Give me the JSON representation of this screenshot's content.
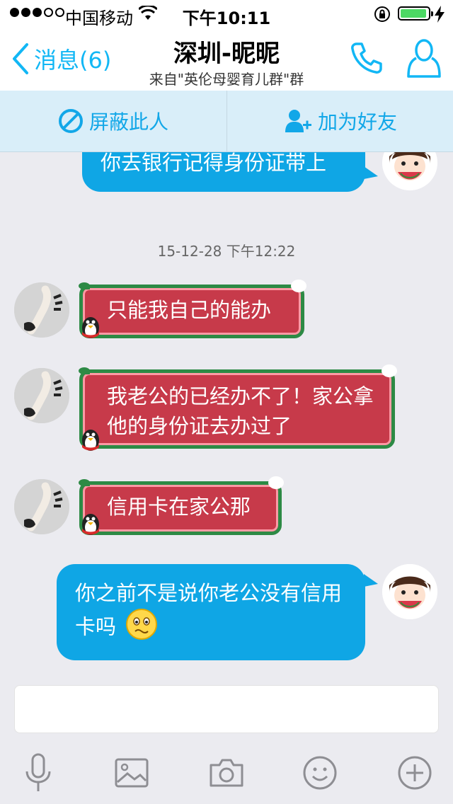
{
  "status_bar": {
    "carrier": "中国移动",
    "time": "下午10:11",
    "battery_level": 0.95
  },
  "nav": {
    "back_label": "消息(6)",
    "title": "深圳-昵昵",
    "subtitle": "来自\"英伦母婴育儿群\"群"
  },
  "actions": {
    "block_label": "屏蔽此人",
    "add_friend_label": "加为好友"
  },
  "messages": [
    {
      "side": "right",
      "style": "blue",
      "text": "你去银行记得身份证带上"
    },
    {
      "type": "timestamp",
      "text": "15-12-28 下午12:22"
    },
    {
      "side": "left",
      "style": "red",
      "text": "只能我自己的能办"
    },
    {
      "side": "left",
      "style": "red",
      "text": "我老公的已经办不了！家公拿他的身份证去办过了"
    },
    {
      "side": "left",
      "style": "red",
      "text": "信用卡在家公那"
    },
    {
      "side": "right",
      "style": "blue",
      "text": "你之前不是说你老公没有信用卡吗",
      "emoji": "worried-face"
    }
  ],
  "toolbar": {
    "icons": [
      "microphone-icon",
      "image-icon",
      "camera-icon",
      "emoji-icon",
      "plus-icon"
    ]
  },
  "colors": {
    "accent": "#12b7f5",
    "blue_bubble": "#0fa6e5",
    "red_bubble": "#c73a4a",
    "red_bubble_border": "#2d8a45",
    "action_bar": "#d9eef9",
    "background": "#ebebf0"
  }
}
